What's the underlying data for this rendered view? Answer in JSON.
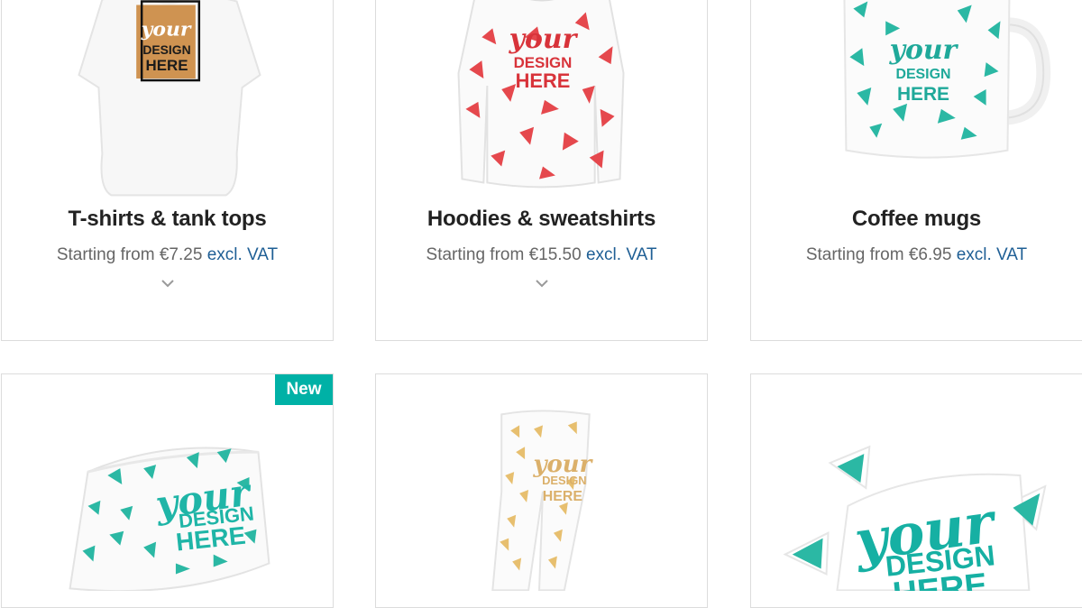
{
  "colors": {
    "title": "#222222",
    "price": "#666666",
    "vat_link": "#1f5f95",
    "badge_bg": "#00b1a6",
    "card_border": "#dcdcdc"
  },
  "design_text": {
    "line1": "your",
    "line2": "DESIGN",
    "line3": "HERE"
  },
  "products": [
    {
      "title": "T-shirts & tank tops",
      "price_prefix": "Starting from €7.25",
      "vat": "excl. VAT",
      "image": "tshirt-mockup"
    },
    {
      "title": "Hoodies & sweatshirts",
      "price_prefix": "Starting from €15.50",
      "vat": "excl. VAT",
      "image": "sweatshirt-mockup"
    },
    {
      "title": "Coffee mugs",
      "price_prefix": "Starting from €6.95",
      "vat": "excl. VAT",
      "image": "mug-mockup"
    },
    {
      "badge": "New",
      "image": "neck-gaiter-mockup"
    },
    {
      "image": "leggings-mockup"
    },
    {
      "image": "sticker-mockup"
    }
  ]
}
